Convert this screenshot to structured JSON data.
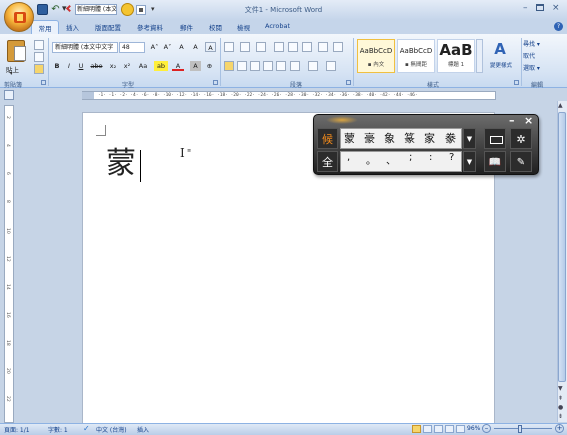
{
  "window": {
    "title": "文件1 - Microsoft Word",
    "quick_access_style": "新細明體 (本文",
    "minimize": "–",
    "close": "×"
  },
  "tabs": [
    "常用",
    "插入",
    "版面配置",
    "參考資料",
    "郵件",
    "校閱",
    "檢視",
    "Acrobat"
  ],
  "ribbon": {
    "clipboard": {
      "paste_label": "貼上",
      "paste_arrow": "▾",
      "group_label": "剪貼簿"
    },
    "font": {
      "font_name": "新細明體 (本文中文字",
      "font_size": "48",
      "grow": "A˄",
      "shrink": "A˅",
      "clear": "A",
      "phonetic": "A",
      "bold": "B",
      "italic": "I",
      "underline": "U",
      "strike": "abe",
      "subscript": "x₂",
      "superscript": "x²",
      "change_case": "Aa",
      "highlight": "ab",
      "font_color": "A",
      "char_shading": "A",
      "enclose": "⊕",
      "group_label": "字型"
    },
    "paragraph": {
      "group_label": "段落"
    },
    "styles": {
      "items": [
        {
          "sample": "AaBbCcD",
          "name": "▪ 內文"
        },
        {
          "sample": "AaBbCcD",
          "name": "▪ 無間距"
        },
        {
          "sample": "AaB",
          "name": "標題 1"
        }
      ],
      "change_styles": "變更樣式",
      "group_label": "樣式"
    },
    "editing": {
      "find": "尋找 ▾",
      "replace": "取代",
      "select": "選取 ▾",
      "group_label": "編輯"
    }
  },
  "ruler": {
    "ticks": "·2·  ·1·  ·1·  ·2·  ·4·  ·6·  ·8·  ·10·  ·12·  ·14·  ·16·  ·18·  ·20·  ·22·  ·24·  ·26·  ·28·  ·30·  ·32·  ·34·  ·36·  ·38·  ·40·  ·42·  ·44·  ·46·",
    "vticks": [
      "2",
      "4",
      "6",
      "8",
      "10",
      "12",
      "14",
      "16",
      "18",
      "20",
      "22"
    ]
  },
  "document": {
    "text": "蒙",
    "cursor": "I",
    "cursor_sub": "≡"
  },
  "ime": {
    "mode": "候",
    "candidates": [
      "蒙",
      "豪",
      "象",
      "篆",
      "家",
      "豢"
    ],
    "cand_arrow": "▼",
    "settings": "✲",
    "width_mode": "全",
    "punctuation": [
      ",",
      "。",
      "、",
      ";",
      ":",
      "?"
    ],
    "punct_arrow": "▼",
    "dict": "📖",
    "tool": "✎",
    "minimize": "–",
    "close": "×"
  },
  "status": {
    "page": "頁面: 1/1",
    "words": "字數: 1",
    "language": "中文 (台灣)",
    "mode": "插入",
    "zoom": "96%",
    "zoom_minus": "–",
    "zoom_plus": "+"
  }
}
